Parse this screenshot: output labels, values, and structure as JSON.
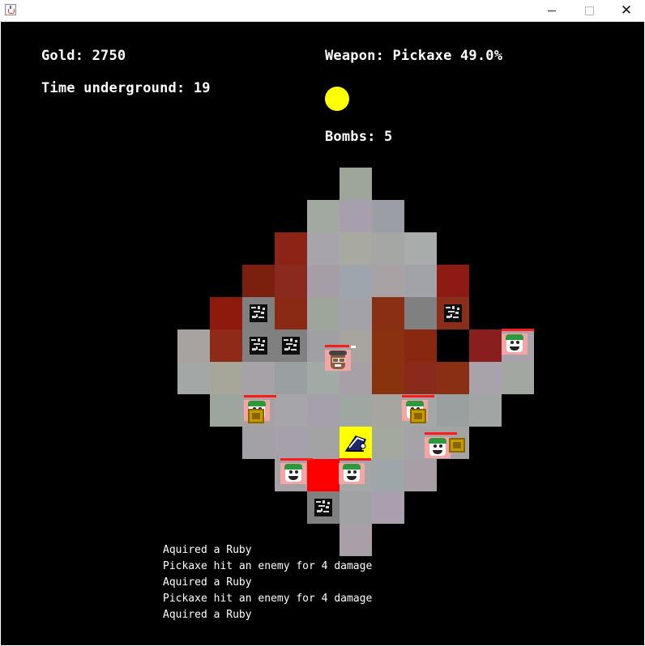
{
  "hud": {
    "gold": "Gold: 2750",
    "time": "Time underground: 19",
    "weapon": "Weapon: Pickaxe 49.0%",
    "bombs": "Bombs: 5"
  },
  "log": [
    "Aquired a Ruby",
    "Pickaxe hit an enemy for 4 damage",
    "Aquired a Ruby",
    "Pickaxe hit an enemy for 4 damage",
    "Aquired a Ruby"
  ],
  "colors": {
    "background": "#000000",
    "hud_text": "#ffffff",
    "sun": "#ffff00",
    "player_tile": "#ffff00",
    "health_bar": "#ff1a1a"
  },
  "icons": {
    "window": "java-coffee-icon",
    "rock": "rock-icon",
    "enemy": "green-hair-enemy-icon",
    "merchant": "merchant-icon",
    "chest": "treasure-chest-icon",
    "player": "miner-helmet-icon",
    "sun": "sun-icon"
  }
}
